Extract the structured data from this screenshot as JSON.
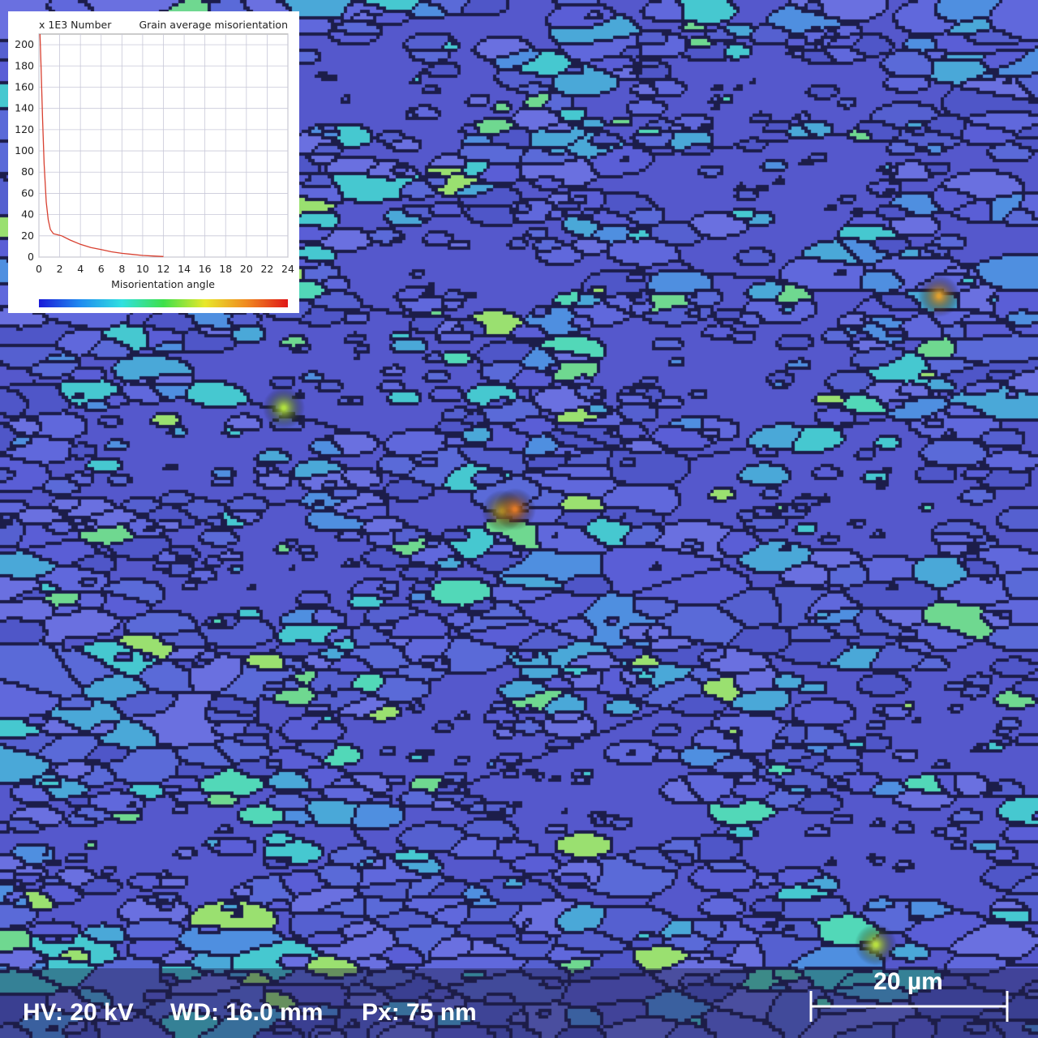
{
  "image": {
    "subject": "EBSD grain average misorientation map",
    "colors": {
      "background": "#4b4fc4",
      "grain_boundary": "#1c1d4a"
    }
  },
  "inset": {
    "unit_label": "x 1E3 Number",
    "title": "Grain average misorientation",
    "xlabel": "Misorientation angle",
    "colorbar_colors": [
      "#1a1ad8",
      "#1f8cf0",
      "#30e0e0",
      "#3ee04a",
      "#e8e82a",
      "#f08a20",
      "#e01818"
    ]
  },
  "chart_data": {
    "type": "line",
    "title": "Grain average misorientation",
    "xlabel": "Misorientation angle",
    "ylabel": "x 1E3 Number",
    "xlim": [
      0,
      24
    ],
    "ylim": [
      0,
      210
    ],
    "grid": true,
    "x_ticks": [
      "0",
      "2",
      "4",
      "6",
      "8",
      "10",
      "12",
      "14",
      "16",
      "18",
      "20",
      "22",
      "24"
    ],
    "y_ticks": [
      "0",
      "20",
      "40",
      "60",
      "80",
      "100",
      "120",
      "140",
      "160",
      "180",
      "200"
    ],
    "series": [
      {
        "color": "#d84030",
        "x": [
          0.1,
          0.2,
          0.35,
          0.5,
          0.7,
          0.9,
          1.1,
          1.4,
          1.8,
          2.2,
          3,
          4,
          5,
          6,
          7,
          8,
          9,
          10,
          11,
          12
        ],
        "y": [
          210,
          180,
          130,
          88,
          52,
          35,
          26,
          22,
          21,
          20,
          16,
          12,
          9,
          7,
          5,
          3.5,
          2.5,
          1.5,
          1,
          0.5
        ]
      }
    ]
  },
  "databar": {
    "hv": "HV: 20 kV",
    "wd": "WD: 16.0 mm",
    "px": "Px: 75 nm",
    "scale_label": "20 µm"
  }
}
